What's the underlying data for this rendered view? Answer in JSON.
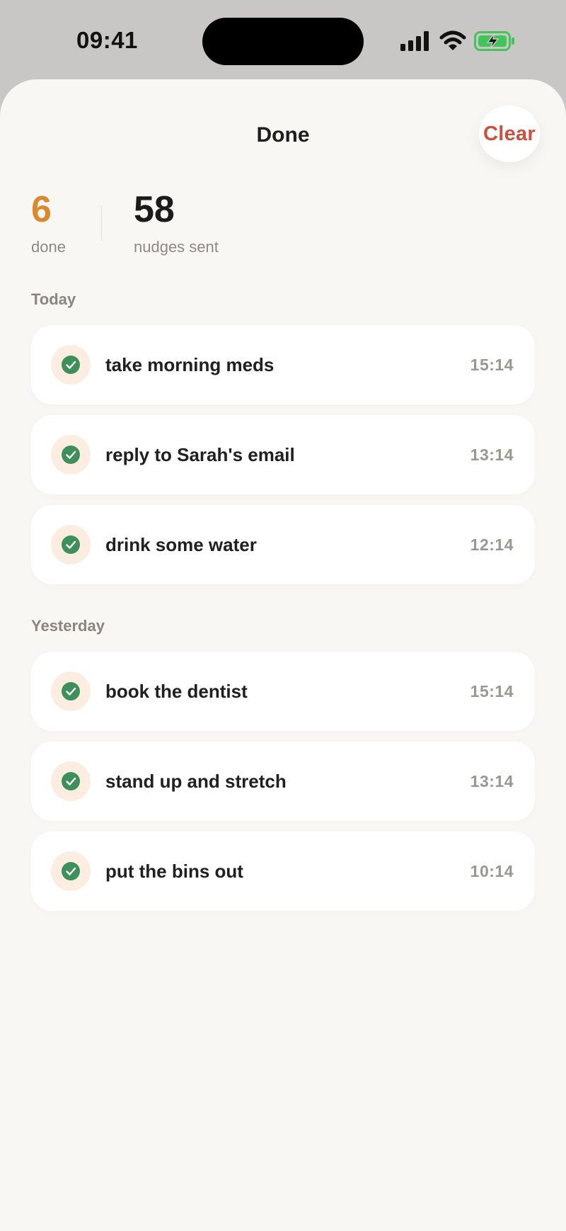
{
  "status_bar": {
    "time": "09:41"
  },
  "header": {
    "title": "Done",
    "clear_label": "Clear"
  },
  "stats": {
    "done_value": "6",
    "done_label": "done",
    "nudges_value": "58",
    "nudges_label": "nudges sent"
  },
  "sections": [
    {
      "title": "Today",
      "items": [
        {
          "label": "take morning meds",
          "time": "15:14"
        },
        {
          "label": "reply to Sarah's email",
          "time": "13:14"
        },
        {
          "label": "drink some water",
          "time": "12:14"
        }
      ]
    },
    {
      "title": "Yesterday",
      "items": [
        {
          "label": "book the dentist",
          "time": "15:14"
        },
        {
          "label": "stand up and stretch",
          "time": "13:14"
        },
        {
          "label": "put the bins out",
          "time": "10:14"
        }
      ]
    }
  ],
  "colors": {
    "accent_orange": "#d98a2e",
    "clear_red": "#c9513f",
    "check_green": "#3f8f5c",
    "battery_green": "#43c45a"
  }
}
